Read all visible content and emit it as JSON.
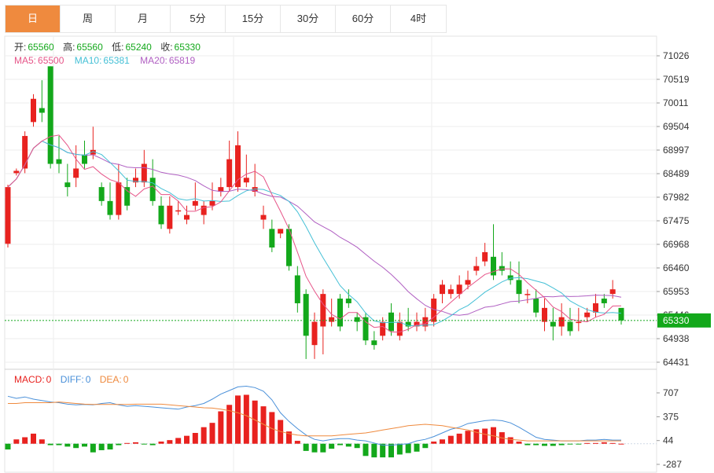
{
  "tabs": [
    "日",
    "周",
    "月",
    "5分",
    "15分",
    "30分",
    "60分",
    "4时"
  ],
  "active_tab": 0,
  "ohlc": {
    "open_label": "开:",
    "open": "65560",
    "high_label": "高:",
    "high": "65560",
    "low_label": "低:",
    "low": "65240",
    "close_label": "收:",
    "close": "65330"
  },
  "ma": {
    "ma5_label": "MA5:",
    "ma5": "65500",
    "ma10_label": "MA10:",
    "ma10": "65381",
    "ma20_label": "MA20:",
    "ma20": "65819"
  },
  "macd_legend": {
    "macd_label": "MACD:",
    "macd": "0",
    "diff_label": "DIFF:",
    "diff": "0",
    "dea_label": "DEA:",
    "dea": "0"
  },
  "colors": {
    "up": "#e8221f",
    "down": "#13a81b",
    "ma5": "#e65488",
    "ma10": "#45c0d6",
    "ma20": "#b05fc2",
    "diff": "#4a90d9",
    "dea": "#ef8a3e",
    "last_price_bg": "#13a81b",
    "grid": "#eeeeee",
    "active_tab": "#ef8a3e"
  },
  "chart_data": {
    "type": "candlestick",
    "price_ticks": [
      "71026",
      "70519",
      "70011",
      "69504",
      "68997",
      "68489",
      "67982",
      "67475",
      "66968",
      "66460",
      "65953",
      "65446",
      "64938",
      "64431"
    ],
    "macd_ticks": [
      "707",
      "375",
      "44",
      "-287"
    ],
    "price_range": [
      64431,
      71026
    ],
    "macd_range": [
      -287,
      707
    ],
    "last_price": "65330",
    "candles": [
      [
        66980,
        68200,
        66900,
        68250
      ],
      [
        68500,
        68550,
        68450,
        68600
      ],
      [
        68600,
        69300,
        68500,
        69400
      ],
      [
        69600,
        70100,
        69500,
        70200
      ],
      [
        69900,
        69800,
        69600,
        70500
      ],
      [
        70800,
        68700,
        68600,
        70800
      ],
      [
        68800,
        68700,
        68500,
        69300
      ],
      [
        68300,
        68200,
        68000,
        68700
      ],
      [
        68400,
        68600,
        68200,
        69100
      ],
      [
        68900,
        68700,
        68600,
        69200
      ],
      [
        68900,
        69000,
        68800,
        69500
      ],
      [
        68200,
        67900,
        67800,
        68300
      ],
      [
        67900,
        67600,
        67500,
        68300
      ],
      [
        67600,
        68300,
        67500,
        68700
      ],
      [
        68200,
        67800,
        67700,
        68400
      ],
      [
        68300,
        68400,
        68200,
        68600
      ],
      [
        68300,
        68700,
        68200,
        69000
      ],
      [
        68400,
        67900,
        67800,
        68800
      ],
      [
        67800,
        67400,
        67300,
        68000
      ],
      [
        67300,
        67800,
        67200,
        68000
      ],
      [
        67700,
        67700,
        67600,
        67900
      ],
      [
        67500,
        67600,
        67400,
        67800
      ],
      [
        67800,
        67900,
        67700,
        68300
      ],
      [
        67600,
        67800,
        67400,
        67900
      ],
      [
        67800,
        67900,
        67700,
        68300
      ],
      [
        68100,
        68200,
        68000,
        68400
      ],
      [
        68200,
        68800,
        68100,
        69200
      ],
      [
        68200,
        69100,
        68100,
        69400
      ],
      [
        68300,
        68400,
        68200,
        68900
      ],
      [
        68100,
        68200,
        68000,
        68700
      ],
      [
        67500,
        67600,
        67300,
        67800
      ],
      [
        67300,
        66900,
        66800,
        67500
      ],
      [
        67200,
        67300,
        67100,
        67300
      ],
      [
        67300,
        66500,
        66400,
        67400
      ],
      [
        66300,
        65700,
        65500,
        66500
      ],
      [
        65900,
        65000,
        64500,
        66000
      ],
      [
        64800,
        65300,
        64500,
        65500
      ],
      [
        65200,
        65900,
        64600,
        66000
      ],
      [
        65300,
        65400,
        65200,
        65800
      ],
      [
        65800,
        65200,
        65100,
        65900
      ],
      [
        65800,
        65700,
        65600,
        66000
      ],
      [
        65400,
        65300,
        65100,
        65500
      ],
      [
        65400,
        64900,
        64800,
        65500
      ],
      [
        64900,
        64800,
        64700,
        65100
      ],
      [
        65000,
        65300,
        64900,
        65400
      ],
      [
        65500,
        65100,
        65000,
        65700
      ],
      [
        65000,
        65300,
        64900,
        65500
      ],
      [
        65300,
        65200,
        65100,
        65600
      ],
      [
        65200,
        65300,
        65100,
        65500
      ],
      [
        65200,
        65400,
        65100,
        65600
      ],
      [
        65300,
        65800,
        65200,
        65900
      ],
      [
        65900,
        66100,
        65700,
        66200
      ],
      [
        65900,
        66000,
        65800,
        66100
      ],
      [
        65900,
        66100,
        65800,
        66300
      ],
      [
        66100,
        66200,
        66000,
        66400
      ],
      [
        66400,
        66500,
        66300,
        66700
      ],
      [
        66600,
        66800,
        66500,
        67000
      ],
      [
        66700,
        66300,
        66200,
        67400
      ],
      [
        66500,
        66400,
        66300,
        66800
      ],
      [
        66300,
        66200,
        66100,
        66600
      ],
      [
        66200,
        65900,
        65700,
        66600
      ],
      [
        65900,
        65900,
        65700,
        66000
      ],
      [
        65800,
        65500,
        65400,
        66000
      ],
      [
        65300,
        65600,
        65100,
        65800
      ],
      [
        65300,
        65200,
        64900,
        65600
      ],
      [
        65200,
        65400,
        65000,
        65700
      ],
      [
        65300,
        65100,
        65000,
        65600
      ],
      [
        65300,
        65300,
        65100,
        65600
      ],
      [
        65400,
        65500,
        65300,
        65600
      ],
      [
        65500,
        65700,
        65400,
        65900
      ],
      [
        65800,
        65700,
        65600,
        65900
      ],
      [
        65900,
        66000,
        65800,
        66200
      ],
      [
        65600,
        65330,
        65240,
        65560
      ]
    ],
    "macd_hist": [
      -80,
      60,
      90,
      140,
      60,
      -20,
      -20,
      -40,
      -60,
      -40,
      -120,
      -90,
      -80,
      -20,
      10,
      20,
      -10,
      -20,
      30,
      50,
      80,
      110,
      150,
      230,
      290,
      450,
      540,
      670,
      680,
      600,
      520,
      440,
      330,
      170,
      40,
      -100,
      -120,
      -120,
      -70,
      -20,
      -40,
      -60,
      -170,
      -190,
      -190,
      -190,
      -150,
      -130,
      -110,
      -60,
      30,
      60,
      110,
      140,
      180,
      200,
      210,
      230,
      160,
      90,
      30,
      -20,
      -20,
      -30,
      -30,
      -20,
      -10,
      -10,
      10,
      10,
      20,
      10,
      0
    ],
    "diff": [
      660,
      630,
      650,
      620,
      600,
      580,
      570,
      550,
      540,
      545,
      540,
      560,
      570,
      540,
      520,
      530,
      520,
      510,
      500,
      490,
      480,
      510,
      530,
      560,
      620,
      690,
      740,
      790,
      800,
      780,
      730,
      610,
      430,
      310,
      210,
      120,
      60,
      40,
      60,
      70,
      70,
      50,
      40,
      10,
      -20,
      -20,
      -10,
      0,
      40,
      60,
      100,
      150,
      200,
      230,
      280,
      300,
      320,
      330,
      320,
      290,
      230,
      160,
      90,
      60,
      50,
      40,
      40,
      40,
      50,
      50,
      60,
      50,
      50
    ],
    "dea": [
      560,
      560,
      570,
      570,
      570,
      570,
      580,
      570,
      560,
      550,
      545,
      545,
      545,
      545,
      545,
      550,
      550,
      550,
      550,
      540,
      530,
      520,
      510,
      500,
      495,
      480,
      460,
      430,
      390,
      330,
      270,
      210,
      170,
      140,
      120,
      110,
      110,
      110,
      110,
      120,
      130,
      140,
      150,
      170,
      190,
      210,
      230,
      250,
      260,
      270,
      260,
      250,
      230,
      210,
      190,
      160,
      130,
      110,
      80,
      60,
      50,
      40,
      40,
      40,
      40,
      40,
      40,
      40,
      40,
      40,
      40,
      40,
      40
    ]
  }
}
